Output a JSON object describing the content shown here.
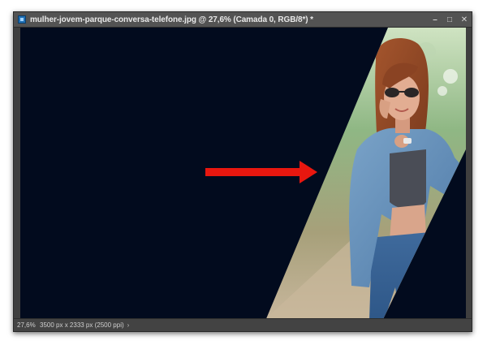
{
  "window": {
    "title": "mulher-jovem-parque-conversa-telefone.jpg @ 27,6% (Camada 0, RGB/8*) *",
    "controls": {
      "minimize": "–",
      "maximize": "□",
      "close": "✕"
    }
  },
  "canvas": {
    "background_color": "#020b1e",
    "arrow_color": "#e8170f",
    "photo_subject": "woman-in-denim-jacket-with-sunglasses-on-phone"
  },
  "status": {
    "zoom": "27,6%",
    "document_info": "3500 px x 2333 px (2500 ppi)",
    "chevron": "›"
  }
}
